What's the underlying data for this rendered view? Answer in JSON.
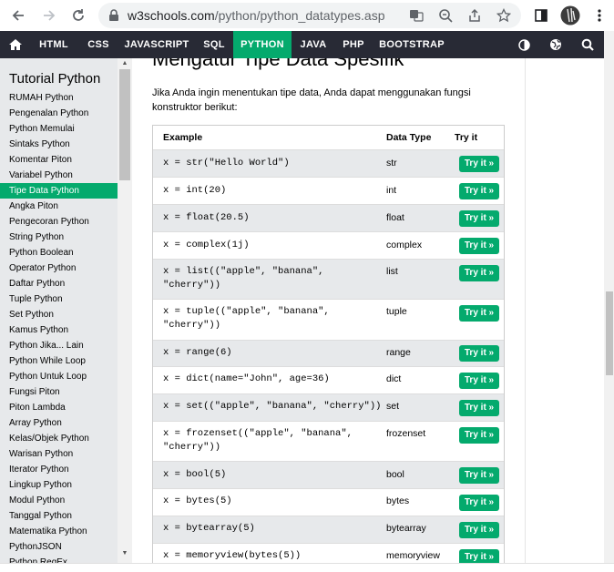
{
  "browser": {
    "url_host": "w3schools.com",
    "url_path": "/python/python_datatypes.asp"
  },
  "topnav": {
    "items": [
      "HTML",
      "CSS",
      "JAVASCRIPT",
      "SQL",
      "PYTHON",
      "JAVA",
      "PHP",
      "BOOTSTRAP"
    ],
    "active": "PYTHON"
  },
  "sidebar": {
    "title": "Tutorial Python",
    "items": [
      "RUMAH Python",
      "Pengenalan Python",
      "Python Memulai",
      "Sintaks Python",
      "Komentar Piton",
      "Variabel Python",
      "Tipe Data Python",
      "Angka Piton",
      "Pengecoran Python",
      "String Python",
      "Python Boolean",
      "Operator Python",
      "Daftar Python",
      "Tuple Python",
      "Set Python",
      "Kamus Python",
      "Python Jika... Lain",
      "Python While Loop",
      "Python Untuk Loop",
      "Fungsi Piton",
      "Piton Lambda",
      "Array Python",
      "Kelas/Objek Python",
      "Warisan Python",
      "Iterator Python",
      "Lingkup Python",
      "Modul Python",
      "Tanggal Python",
      "Matematika Python",
      "PythonJSON",
      "Python RegEx"
    ],
    "active_index": 6
  },
  "main": {
    "heading": "Mengatur Tipe Data Spesifik",
    "intro": "Jika Anda ingin menentukan tipe data, Anda dapat menggunakan fungsi konstruktor berikut:",
    "table": {
      "headers": [
        "Example",
        "Data Type",
        "Try it"
      ],
      "try_label": "Try it »",
      "rows": [
        {
          "example": "x = str(\"Hello World\")",
          "type": "str"
        },
        {
          "example": "x = int(20)",
          "type": "int"
        },
        {
          "example": "x = float(20.5)",
          "type": "float"
        },
        {
          "example": "x = complex(1j)",
          "type": "complex"
        },
        {
          "example": "x = list((\"apple\", \"banana\", \"cherry\"))",
          "type": "list"
        },
        {
          "example": "x = tuple((\"apple\", \"banana\", \"cherry\"))",
          "type": "tuple"
        },
        {
          "example": "x = range(6)",
          "type": "range"
        },
        {
          "example": "x = dict(name=\"John\", age=36)",
          "type": "dict"
        },
        {
          "example": "x = set((\"apple\", \"banana\", \"cherry\"))",
          "type": "set"
        },
        {
          "example": "x = frozenset((\"apple\", \"banana\", \"cherry\"))",
          "type": "frozenset"
        },
        {
          "example": "x = bool(5)",
          "type": "bool"
        },
        {
          "example": "x = bytes(5)",
          "type": "bytes"
        },
        {
          "example": "x = bytearray(5)",
          "type": "bytearray"
        },
        {
          "example": "x = memoryview(bytes(5))",
          "type": "memoryview"
        }
      ]
    }
  },
  "colors": {
    "accent": "#04aa6d",
    "topnav_bg": "#282a35",
    "sidebar_bg": "#e7e9eb"
  }
}
